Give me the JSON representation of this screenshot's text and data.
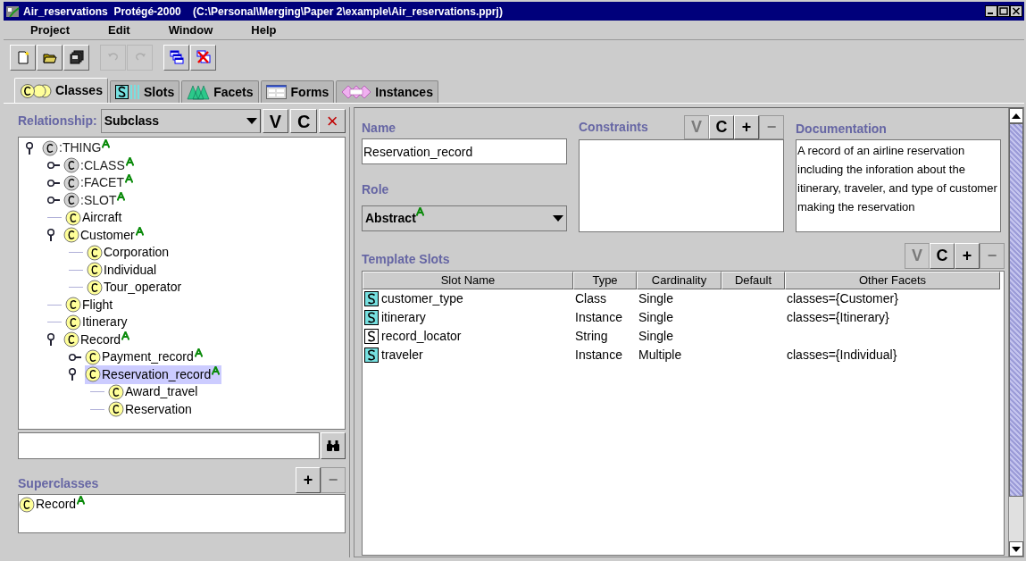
{
  "window": {
    "title": "Air_reservations  Protégé-2000    (C:\\Personal\\Merging\\Paper 2\\example\\Air_reservations.pprj)"
  },
  "menu": [
    "Project",
    "Edit",
    "Window",
    "Help"
  ],
  "toolbar": [
    {
      "kind": "new",
      "disabled": false
    },
    {
      "kind": "open",
      "disabled": false
    },
    {
      "kind": "save",
      "disabled": false
    },
    {
      "kind": "undo",
      "disabled": true
    },
    {
      "kind": "redo",
      "disabled": true
    },
    {
      "kind": "cascade",
      "disabled": false
    },
    {
      "kind": "close_all",
      "disabled": false
    }
  ],
  "tabs": [
    {
      "label": "Classes",
      "kind": "classes",
      "selected": true
    },
    {
      "label": "Slots",
      "kind": "slots",
      "selected": false
    },
    {
      "label": "Facets",
      "kind": "facets",
      "selected": false
    },
    {
      "label": "Forms",
      "kind": "forms",
      "selected": false
    },
    {
      "label": "Instances",
      "kind": "instances",
      "selected": false
    }
  ],
  "classes_panel": {
    "relationship_label": "Relationship:",
    "relationship": "Subclass",
    "buttons": [
      {
        "label": "V",
        "disabled": false,
        "danger": false
      },
      {
        "label": "C",
        "disabled": false,
        "danger": false
      },
      {
        "label": "×",
        "disabled": false,
        "danger": true
      }
    ],
    "tree": [
      {
        "label": ":THING",
        "kind": "branch",
        "system": true,
        "abstract": true,
        "expanded": true,
        "selected": false,
        "children": [
          {
            "label": ":CLASS",
            "kind": "branch",
            "system": true,
            "abstract": true,
            "expanded": false,
            "selected": false
          },
          {
            "label": ":FACET",
            "kind": "branch",
            "system": true,
            "abstract": true,
            "expanded": false,
            "selected": false
          },
          {
            "label": ":SLOT",
            "kind": "branch",
            "system": true,
            "abstract": true,
            "expanded": false,
            "selected": false
          },
          {
            "label": "Aircraft",
            "kind": "leaf",
            "system": false,
            "abstract": false,
            "selected": false
          },
          {
            "label": "Customer",
            "kind": "branch",
            "system": false,
            "abstract": true,
            "expanded": true,
            "selected": false,
            "children": [
              {
                "label": "Corporation",
                "kind": "leaf",
                "system": false,
                "abstract": false,
                "selected": false
              },
              {
                "label": "Individual",
                "kind": "leaf",
                "system": false,
                "abstract": false,
                "selected": false
              },
              {
                "label": "Tour_operator",
                "kind": "leaf",
                "system": false,
                "abstract": false,
                "selected": false
              }
            ]
          },
          {
            "label": "Flight",
            "kind": "leaf",
            "system": false,
            "abstract": false,
            "selected": false
          },
          {
            "label": "Itinerary",
            "kind": "leaf",
            "system": false,
            "abstract": false,
            "selected": false
          },
          {
            "label": "Record",
            "kind": "branch",
            "system": false,
            "abstract": true,
            "expanded": true,
            "selected": false,
            "children": [
              {
                "label": "Payment_record",
                "kind": "branch",
                "system": false,
                "abstract": true,
                "expanded": false,
                "selected": false
              },
              {
                "label": "Reservation_record",
                "kind": "branch",
                "system": false,
                "abstract": true,
                "expanded": true,
                "selected": true,
                "children": [
                  {
                    "label": "Award_travel",
                    "kind": "leaf",
                    "system": false,
                    "abstract": false,
                    "selected": false
                  },
                  {
                    "label": "Reservation",
                    "kind": "leaf",
                    "system": false,
                    "abstract": false,
                    "selected": false
                  }
                ]
              }
            ]
          }
        ]
      }
    ],
    "superclasses_label": "Superclasses",
    "superclass_buttons": [
      {
        "label": "+",
        "disabled": false
      },
      {
        "label": "−",
        "disabled": true
      }
    ],
    "superclasses": [
      {
        "label": "Record",
        "abstract": true
      }
    ]
  },
  "class_form": {
    "name_label": "Name",
    "name": "Reservation_record",
    "role_label": "Role",
    "role": "Abstract",
    "role_abstract": true,
    "constraints_label": "Constraints",
    "constraint_buttons": [
      {
        "label": "V",
        "disabled": true
      },
      {
        "label": "C",
        "disabled": false
      },
      {
        "label": "+",
        "disabled": false
      },
      {
        "label": "−",
        "disabled": true
      }
    ],
    "documentation_label": "Documentation",
    "documentation": "A record of an airline reservation including the inforation about the itinerary, traveler, and type of customer making the reservation",
    "template_slots_label": "Template Slots",
    "slot_buttons": [
      {
        "label": "V",
        "disabled": true
      },
      {
        "label": "C",
        "disabled": false
      },
      {
        "label": "+",
        "disabled": false
      },
      {
        "label": "−",
        "disabled": true
      }
    ],
    "table": {
      "columns": [
        "Slot Name",
        "Type",
        "Cardinality",
        "Default",
        "Other Facets"
      ],
      "rows": [
        {
          "highlighted": true,
          "cells": [
            "customer_type",
            "Class",
            "Single",
            "",
            "classes={Customer}"
          ]
        },
        {
          "highlighted": true,
          "cells": [
            "itinerary",
            "Instance",
            "Single",
            "",
            "classes={Itinerary}"
          ]
        },
        {
          "highlighted": false,
          "cells": [
            "record_locator",
            "String",
            "Single",
            "",
            ""
          ]
        },
        {
          "highlighted": true,
          "cells": [
            "traveler",
            "Instance",
            "Multiple",
            "",
            "classes={Individual}"
          ]
        }
      ]
    }
  }
}
